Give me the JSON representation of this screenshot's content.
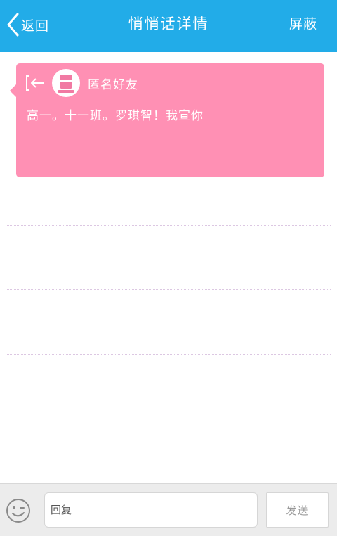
{
  "header": {
    "back_label": "返回",
    "title": "悄悄话详情",
    "block_label": "屏蔽"
  },
  "message": {
    "sender": "匿名好友",
    "text": "高一。十一班。罗琪智！我宣你"
  },
  "footer": {
    "reply_placeholder": "回复",
    "send_label": "发送"
  },
  "colors": {
    "header_bg": "#22ace8",
    "card_bg": "#ff90b4",
    "footer_bg": "#ececec"
  },
  "icons": {
    "back": "chevron-left-icon",
    "exit": "exit-arrow-icon",
    "avatar": "anonymous-avatar-icon",
    "emoji": "smiley-icon"
  }
}
